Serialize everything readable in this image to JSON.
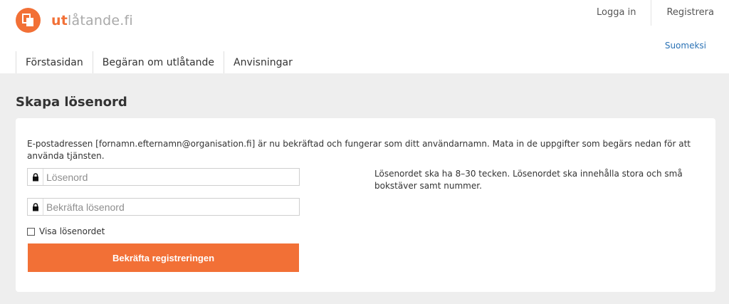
{
  "brand": {
    "name_bold": "ut",
    "name_rest": "låtande.fi",
    "logo_color": "#f27036",
    "icon": "documents-icon"
  },
  "top_links": {
    "login": "Logga in",
    "register": "Registrera"
  },
  "language_link": "Suomeksi",
  "nav": {
    "items": [
      {
        "label": "Förstasidan"
      },
      {
        "label": "Begäran om utlåtande"
      },
      {
        "label": "Anvisningar"
      }
    ]
  },
  "page": {
    "title": "Skapa lösenord",
    "intro": "E-postadressen [fornamn.efternamn@organisation.fi] är nu bekräftad och fungerar som ditt användarnamn. Mata in de uppgifter som begärs nedan för att använda tjänsten."
  },
  "form": {
    "password_placeholder": "Lösenord",
    "confirm_placeholder": "Bekräfta lösenord",
    "show_password_label": "Visa lösenordet",
    "show_password_checked": false,
    "submit_label": "Bekräfta registreringen",
    "lock_icon": "lock-icon"
  },
  "hint": "Lösenordet ska ha 8–30 tecken. Lösenordet ska innehålla stora och små bokstäver samt nummer.",
  "colors": {
    "accent": "#f27036",
    "link": "#2a72b5",
    "background": "#eeeeee"
  }
}
